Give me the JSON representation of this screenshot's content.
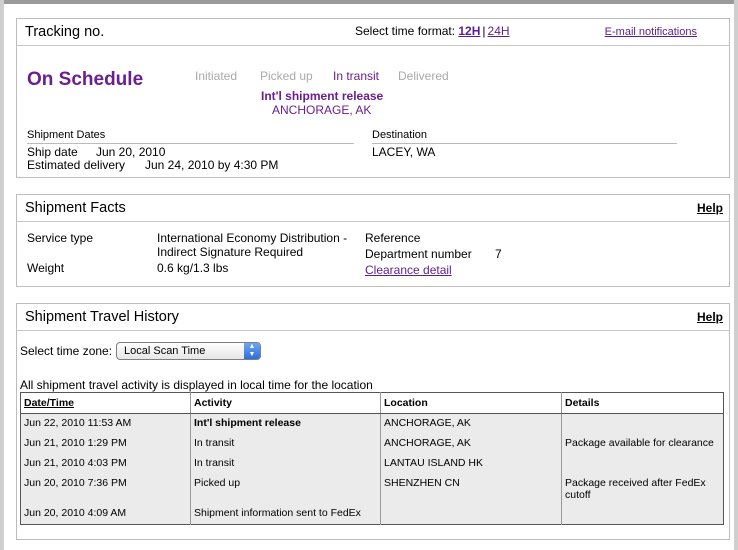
{
  "tracking": {
    "title": "Tracking no.",
    "time_format_label": "Select time format:",
    "time_format_12h": "12H",
    "time_format_sep": "|",
    "time_format_24h": "24H",
    "email_notifications": "E-mail notifications",
    "status": "On Schedule",
    "steps": [
      "Initiated",
      "Picked up",
      "In transit",
      "Delivered"
    ],
    "current_step": "In transit",
    "status_event": "Int'l shipment release",
    "status_location": "ANCHORAGE, AK",
    "shipment_dates_label": "Shipment Dates",
    "ship_date_label": "Ship date",
    "ship_date_value": "Jun 20, 2010",
    "estimated_delivery_label": "Estimated delivery",
    "estimated_delivery_value": "Jun 24, 2010 by 4:30 PM",
    "destination_label": "Destination",
    "destination_value": "LACEY, WA"
  },
  "facts": {
    "title": "Shipment Facts",
    "help": "Help",
    "service_type_label": "Service type",
    "service_type_line1": "International Economy Distribution -",
    "service_type_line2": "Indirect Signature Required",
    "weight_label": "Weight",
    "weight_value": "0.6 kg/1.3 lbs",
    "reference_label": "Reference",
    "department_number_label": "Department number",
    "department_number_value": "7",
    "clearance_detail": "Clearance detail"
  },
  "history": {
    "title": "Shipment Travel History",
    "help": "Help",
    "time_zone_label": "Select time zone:",
    "time_zone_value": "Local Scan Time",
    "note": "All shipment travel activity is displayed in local time for the location",
    "columns": [
      "Date/Time",
      "Activity",
      "Location",
      "Details"
    ],
    "rows": [
      {
        "datetime": "Jun 22, 2010 11:53 AM",
        "activity": "Int'l shipment release",
        "location": "ANCHORAGE, AK",
        "details": ""
      },
      {
        "datetime": "Jun 21, 2010 1:29 PM",
        "activity": "In transit",
        "location": "ANCHORAGE, AK",
        "details": "Package available for clearance"
      },
      {
        "datetime": "Jun 21, 2010 4:03 PM",
        "activity": "In transit",
        "location": "LANTAU ISLAND HK",
        "details": ""
      },
      {
        "datetime": "Jun 20, 2010 7:36 PM",
        "activity": "Picked up",
        "location": "SHENZHEN CN",
        "details": "Package received after FedEx cutoff"
      },
      {
        "datetime": "Jun 20, 2010 4:09 AM",
        "activity": "Shipment information sent to FedEx",
        "location": "",
        "details": ""
      }
    ]
  },
  "colors": {
    "brand_purple": "#6b1e8f",
    "link_purple": "#5a1f8e",
    "inactive_step": "#aaaaaa",
    "row_shade": "#ebebeb"
  }
}
